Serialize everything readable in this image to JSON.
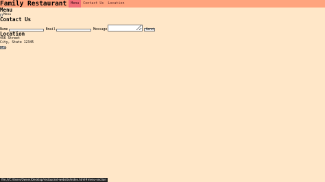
{
  "header": {
    "title": "Family Restaurant",
    "nav": [
      {
        "label": "Menu"
      },
      {
        "label": "Contact Us"
      },
      {
        "label": "Location"
      }
    ]
  },
  "menu_section": {
    "title": "Menu",
    "image_alt": "Menu"
  },
  "contact_section": {
    "title": "Contact Us",
    "form": {
      "name_label": "Name",
      "email_label": "Email",
      "message_label": "Message",
      "send_label": "Send"
    }
  },
  "location_section": {
    "title": "Location",
    "address_line1": "456 Street",
    "address_line2": "City, State 12345",
    "map_button_label": "Map"
  },
  "status_bar": {
    "url": "file:///C:/Users/Owner/Desktop/restaurant-website/index.html#menu-section"
  },
  "colors": {
    "background": "#FFE7C8",
    "header": "#FFA47E",
    "nav_active": "#F36D77"
  }
}
